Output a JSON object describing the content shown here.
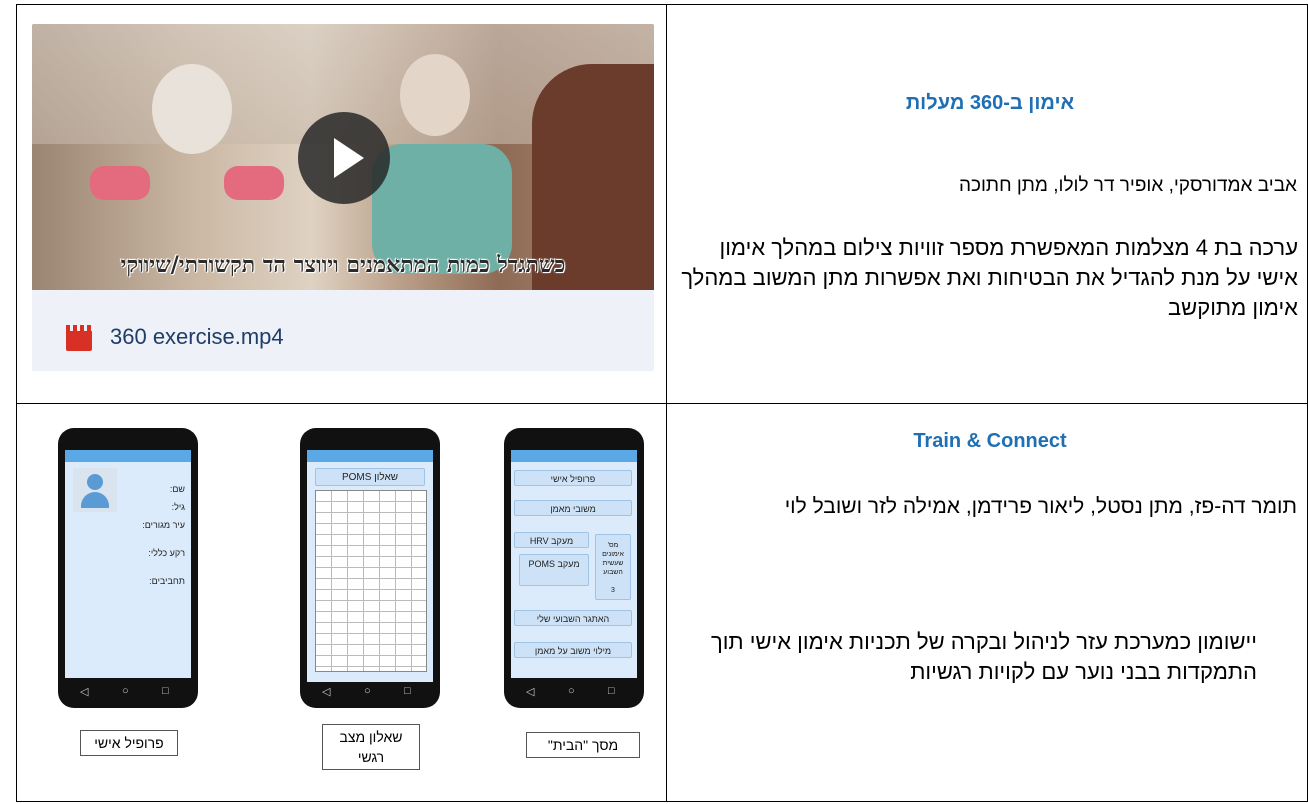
{
  "row1": {
    "title": "אימון ב-360 מעלות",
    "authors": "אביב אמדורסקי, אופיר דר לולו, מתן חתוכה",
    "description": "ערכה בת 4 מצלמות המאפשרת מספר זוויות צילום במהלך אימון אישי על מנת להגדיל את הבטיחות ואת אפשרות מתן המשוב במהלך אימון מתוקשב",
    "video": {
      "caption": "כשתגדל כמות המתאמנים ויווצר הד תקשורתי/שיווקי",
      "filename": "360 exercise.mp4",
      "icon": "video-file-icon"
    }
  },
  "row2": {
    "title": "Train & Connect",
    "authors": "תומר דה-פז, מתן נסטל, ליאור פרידמן, אמילה לזר ושובל לוי",
    "description": "יישומון כמערכת עזר לניהול ובקרה של תכניות אימון אישי תוך התמקדות בבני נוער עם לקויות רגשיות",
    "phones": {
      "home": {
        "label": "מסך \"הבית\"",
        "buttons": [
          "פרופיל אישי",
          "משובי מאמן",
          "מעקב HRV",
          "מעקב POMS",
          "האתגר השבועי שלי",
          "מילוי משוב על מאמן"
        ],
        "counter_title": "מס' אימונים שעשית השבוע",
        "counter_value": "3"
      },
      "poms": {
        "label": "שאלון מצב רגשי",
        "header": "שאלון POMS"
      },
      "profile": {
        "label": "פרופיל אישי",
        "fields": [
          "שם:",
          "גיל:",
          "עיר מגורים:",
          "רקע כללי:",
          "תחביבים:"
        ]
      }
    }
  }
}
